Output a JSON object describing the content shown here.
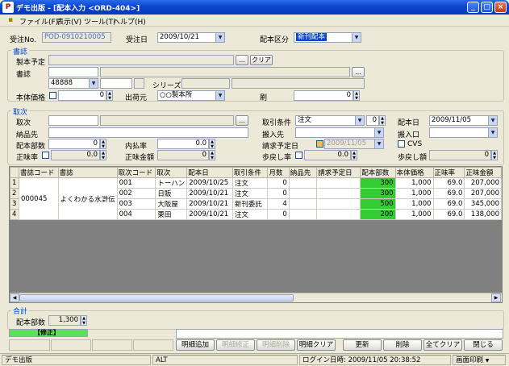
{
  "window": {
    "title": "デモ出版 - [配本入力 <ORD-404>]",
    "icon_text": "P"
  },
  "menu": [
    "ファイル(F)",
    "表示(V)",
    "ツール(T)",
    "ヘルプ(H)"
  ],
  "header": {
    "order_no_label": "受注No.",
    "order_no": "POD-0910210005",
    "order_date_label": "受注日",
    "order_date": "2009/10/21",
    "category_label": "配本区分",
    "category": "新刊配本"
  },
  "books": {
    "title": "書誌",
    "planned_label": "製本予定",
    "clear_label": "クリア",
    "dots": "...",
    "book_label": "書誌",
    "code1": "48888",
    "series_label": "シリーズ",
    "price_label": "本体価格",
    "price": "0",
    "shipper_label": "出荷元",
    "shipper": "○○製本所",
    "print_label": "刷",
    "print": "0"
  },
  "dealer": {
    "title": "取次",
    "dealer_label": "取次",
    "dots": "...",
    "terms_label": "取引条件",
    "terms": "注文",
    "terms_num": "0",
    "dist_date_label": "配本日",
    "dist_date": "2009/11/05",
    "delivery_label": "納品先",
    "carry_to_label": "搬入先",
    "carry_gate_label": "搬入口",
    "count_label": "配本部数",
    "count": "0",
    "inner_rate_label": "内払率",
    "inner_rate": "0.0",
    "billing_date_label": "請求予定日",
    "billing_date": "2009/11/05",
    "cvs_label": "CVS",
    "rate_label": "正味率",
    "rate": "0.0",
    "net_amount_label": "正味金額",
    "net_amount": "0",
    "return_rate_label": "歩戻し率",
    "return_rate": "0.0",
    "return_amount_label": "歩戻し額",
    "return_amount": "0"
  },
  "table": {
    "columns": [
      "書誌コード",
      "書誌",
      "取次コード",
      "取次",
      "配本日",
      "取引条件",
      "月数",
      "納品先",
      "請求予定日",
      "配本部数",
      "本体価格",
      "正味率",
      "正味金額"
    ],
    "book_code": "000045",
    "book_name": "よくわかる水滸伝",
    "rows": [
      {
        "no": "1",
        "dealer_code": "001",
        "dealer": "トーハン",
        "date": "2009/10/25",
        "terms": "注文",
        "months": "0",
        "count": "300",
        "price": "1,000",
        "rate": "69.0",
        "net": "207,000"
      },
      {
        "no": "2",
        "dealer_code": "002",
        "dealer": "日販",
        "date": "2009/10/21",
        "terms": "注文",
        "months": "0",
        "count": "300",
        "price": "1,000",
        "rate": "69.0",
        "net": "207,000"
      },
      {
        "no": "3",
        "dealer_code": "003",
        "dealer": "大阪屋",
        "date": "2009/10/21",
        "terms": "新刊委託",
        "months": "4",
        "count": "500",
        "price": "1,000",
        "rate": "69.0",
        "net": "345,000"
      },
      {
        "no": "4",
        "dealer_code": "004",
        "dealer": "栗田",
        "date": "2009/10/21",
        "terms": "注文",
        "months": "0",
        "count": "200",
        "price": "1,000",
        "rate": "69.0",
        "net": "138,000"
      }
    ]
  },
  "total": {
    "title": "合計",
    "count_label": "配本部数",
    "count": "1,300"
  },
  "mode_label": "【修正】",
  "buttons": {
    "detail_add": "明細追加",
    "detail_edit": "明細修正",
    "detail_delete": "明細削除",
    "detail_clear": "明細クリア",
    "update": "更新",
    "delete": "削除",
    "clear_all": "全てクリア",
    "close": "閉じる"
  },
  "status": {
    "company": "デモ出版",
    "ime": "ALT",
    "login": "ログイン日時: 2009/11/05 20:38:52",
    "print": "画面印刷"
  },
  "colors": {
    "title_blue": "#0a46d0",
    "accent_green": "#33cc33",
    "selection_blue": "#0a46d0"
  }
}
